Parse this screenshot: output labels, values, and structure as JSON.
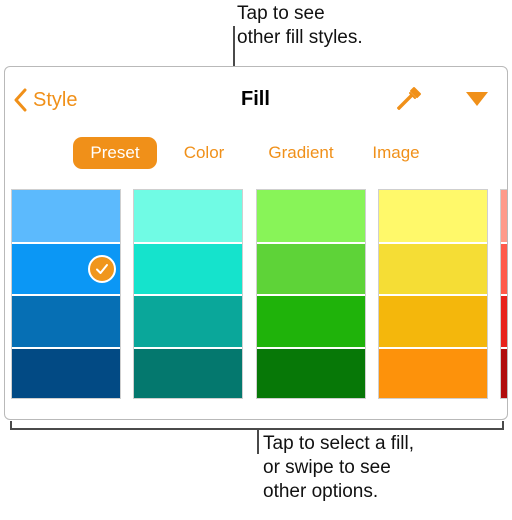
{
  "callouts": {
    "top": [
      "Tap to see",
      "other fill styles."
    ],
    "bottom": [
      "Tap to select a fill,",
      "or swipe to see",
      "other options."
    ]
  },
  "header": {
    "back_label": "Style",
    "title": "Fill",
    "icons": [
      "chevron-left-icon",
      "eyedropper-icon",
      "triangle-down-icon"
    ]
  },
  "tabs": [
    {
      "label": "Preset",
      "selected": true
    },
    {
      "label": "Color",
      "selected": false
    },
    {
      "label": "Gradient",
      "selected": false
    },
    {
      "label": "Image",
      "selected": false
    }
  ],
  "swatch_columns": [
    {
      "name": "blue",
      "swatches": [
        "#5cbafd",
        "#0b97f5",
        "#066fb4",
        "#024a84"
      ],
      "selected_index": 1
    },
    {
      "name": "teal",
      "swatches": [
        "#70fbe4",
        "#15e3cc",
        "#0aa79a",
        "#04786e"
      ],
      "selected_index": null
    },
    {
      "name": "green",
      "swatches": [
        "#88f458",
        "#5ed338",
        "#1fb30a",
        "#077807"
      ],
      "selected_index": null
    },
    {
      "name": "yellow",
      "swatches": [
        "#fff96a",
        "#f5dd35",
        "#f4b70c",
        "#fd920b"
      ],
      "selected_index": null
    },
    {
      "name": "red",
      "swatches": [
        "#ff9a8a",
        "#ff5a4a",
        "#e8221c",
        "#b10d0d"
      ],
      "selected_index": null
    }
  ],
  "colors": {
    "accent": "#f09019",
    "line": "#4a4a4a"
  }
}
